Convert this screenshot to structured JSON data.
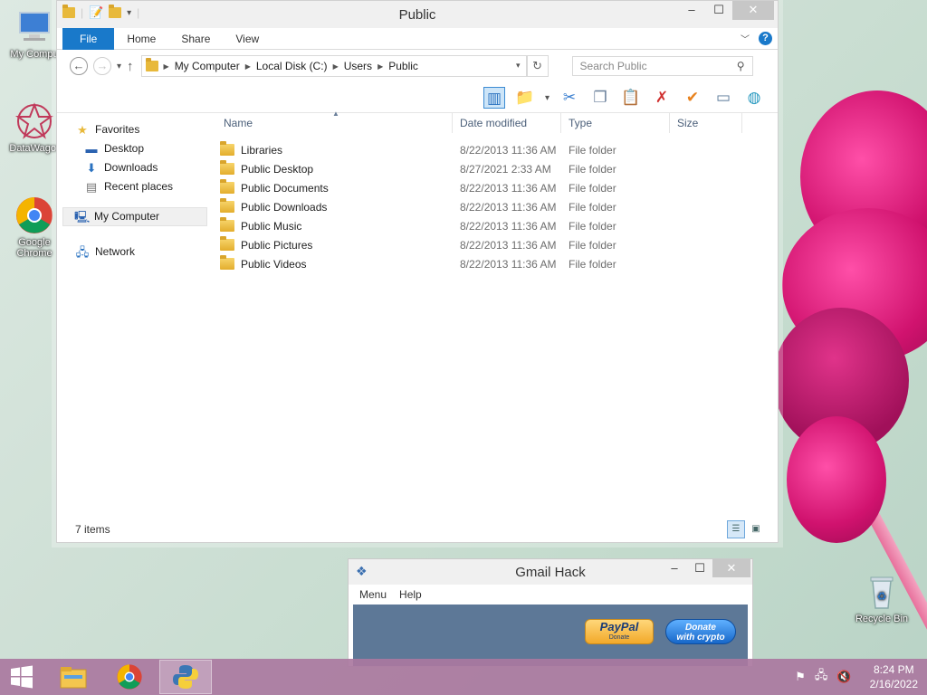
{
  "desktop": {
    "icons": [
      {
        "label": "My Compu"
      },
      {
        "label": "DataWagor"
      },
      {
        "label": "Google Chrome"
      },
      {
        "label": "Recycle Bin"
      }
    ]
  },
  "explorer": {
    "title": "Public",
    "ribbon_tabs": [
      "File",
      "Home",
      "Share",
      "View"
    ],
    "address": [
      "My Computer",
      "Local Disk (C:)",
      "Users",
      "Public"
    ],
    "search_placeholder": "Search Public",
    "nav": {
      "favorites": "Favorites",
      "desktop": "Desktop",
      "downloads": "Downloads",
      "recent": "Recent places",
      "computer": "My Computer",
      "network": "Network"
    },
    "columns": [
      "Name",
      "Date modified",
      "Type",
      "Size"
    ],
    "rows": [
      {
        "name": "Libraries",
        "date": "8/22/2013 11:36 AM",
        "type": "File folder"
      },
      {
        "name": "Public Desktop",
        "date": "8/27/2021 2:33 AM",
        "type": "File folder"
      },
      {
        "name": "Public Documents",
        "date": "8/22/2013 11:36 AM",
        "type": "File folder"
      },
      {
        "name": "Public Downloads",
        "date": "8/22/2013 11:36 AM",
        "type": "File folder"
      },
      {
        "name": "Public Music",
        "date": "8/22/2013 11:36 AM",
        "type": "File folder"
      },
      {
        "name": "Public Pictures",
        "date": "8/22/2013 11:36 AM",
        "type": "File folder"
      },
      {
        "name": "Public Videos",
        "date": "8/22/2013 11:36 AM",
        "type": "File folder"
      }
    ],
    "status": "7 items"
  },
  "gmail": {
    "title": "Gmail Hack",
    "menu": [
      "Menu",
      "Help"
    ],
    "paypal_label": "PayPal",
    "paypal_sub": "Donate",
    "crypto_line1": "Donate",
    "crypto_line2": "with crypto"
  },
  "taskbar": {
    "time": "8:24 PM",
    "date": "2/16/2022"
  },
  "colors": {
    "accent": "#1979ca",
    "folder": "#e8b93b",
    "taskbar": "#aa78a0"
  }
}
